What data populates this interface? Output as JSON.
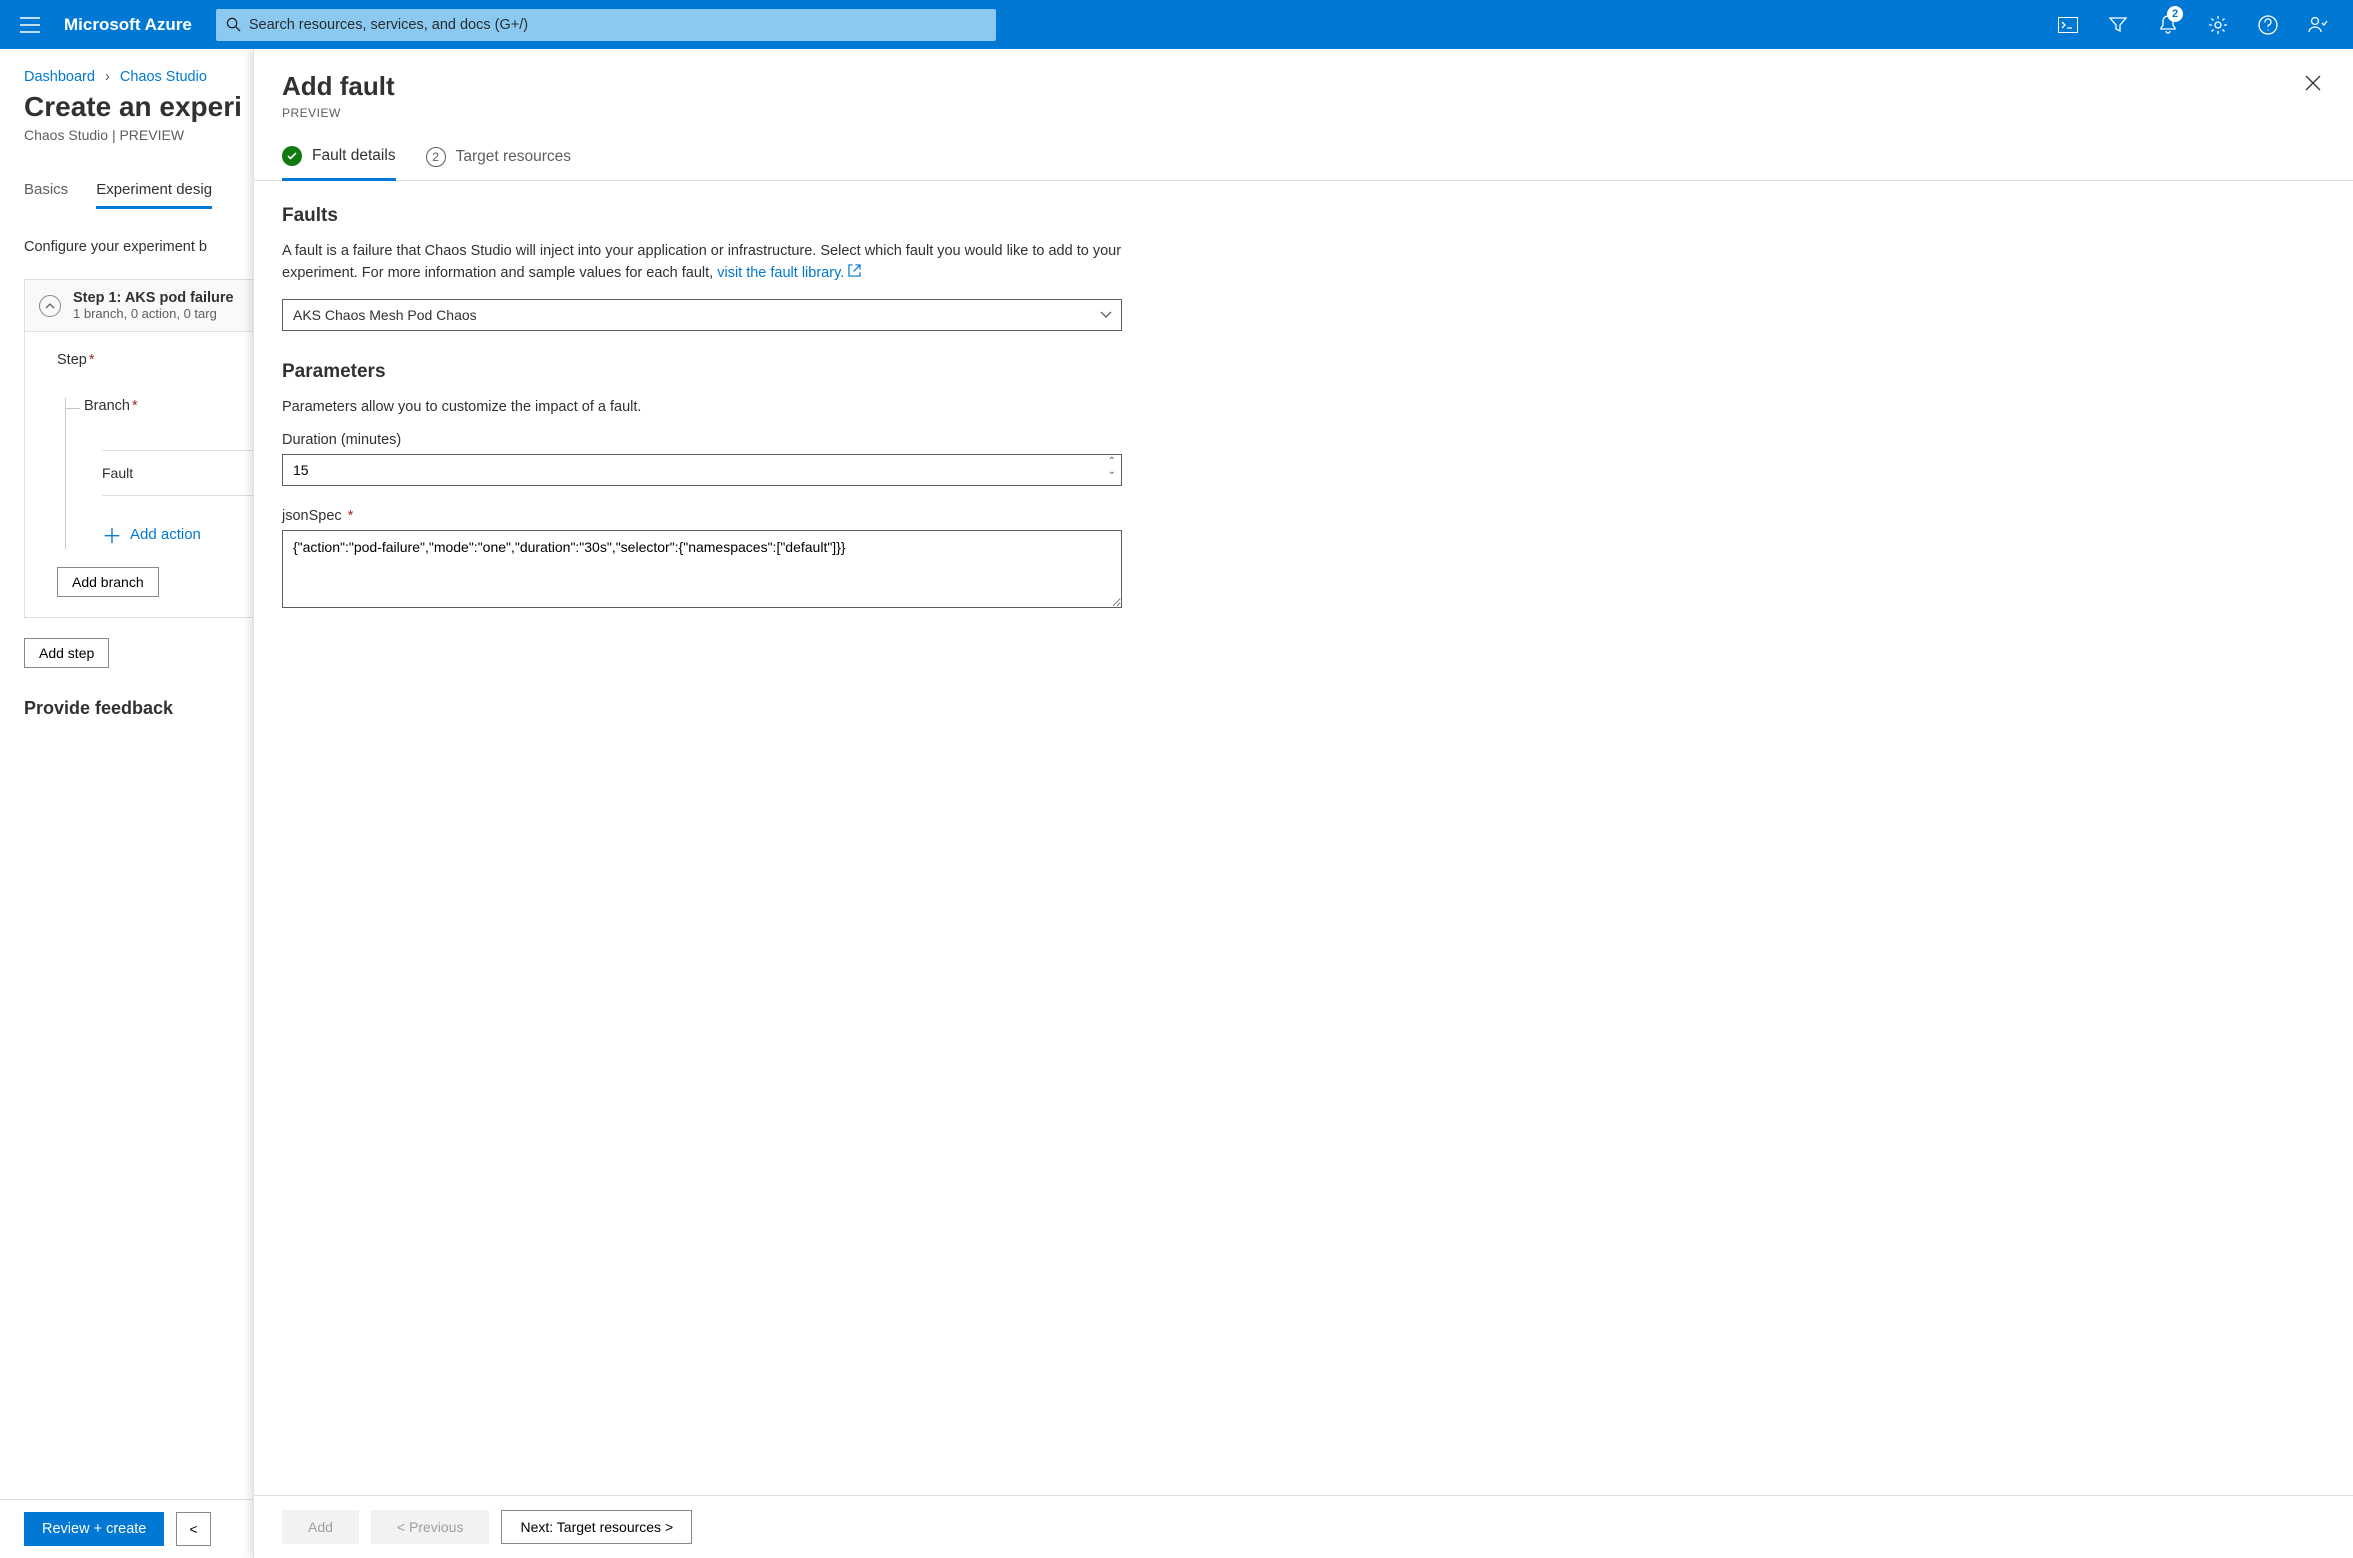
{
  "topbar": {
    "brand": "Microsoft Azure",
    "search_placeholder": "Search resources, services, and docs (G+/)",
    "notification_count": "2"
  },
  "breadcrumb": {
    "item1": "Dashboard",
    "item2": "Chaos Studio"
  },
  "page": {
    "title": "Create an experi",
    "subtitle": "Chaos Studio | PREVIEW",
    "tab_basics": "Basics",
    "tab_designer": "Experiment desig",
    "config_desc": "Configure your experiment b",
    "step_title": "Step 1: AKS pod failure",
    "step_sub": "1 branch, 0 action, 0 targ",
    "step_label": "Step",
    "branch_label": "Branch",
    "fault_label": "Fault",
    "add_action": "Add action",
    "add_branch": "Add branch",
    "add_step": "Add step",
    "feedback": "Provide feedback",
    "review_create": "Review + create",
    "prev_btn": "<"
  },
  "blade": {
    "title": "Add fault",
    "subtitle": "PREVIEW",
    "tab1": "Fault details",
    "tab2": "Target resources",
    "tab2_num": "2",
    "faults_h": "Faults",
    "faults_p1": "A fault is a failure that Chaos Studio will inject into your application or infrastructure. Select which fault you would like to add to your experiment. For more information and sample values for each fault, ",
    "faults_link": "visit the fault library.",
    "fault_selected": "AKS Chaos Mesh Pod Chaos",
    "params_h": "Parameters",
    "params_p": "Parameters allow you to customize the impact of a fault.",
    "duration_label": "Duration (minutes)",
    "duration_value": "15",
    "jsonspec_label": "jsonSpec",
    "jsonspec_value": "{\"action\":\"pod-failure\",\"mode\":\"one\",\"duration\":\"30s\",\"selector\":{\"namespaces\":[\"default\"]}}",
    "btn_add": "Add",
    "btn_prev": "< Previous",
    "btn_next": "Next: Target resources >"
  }
}
